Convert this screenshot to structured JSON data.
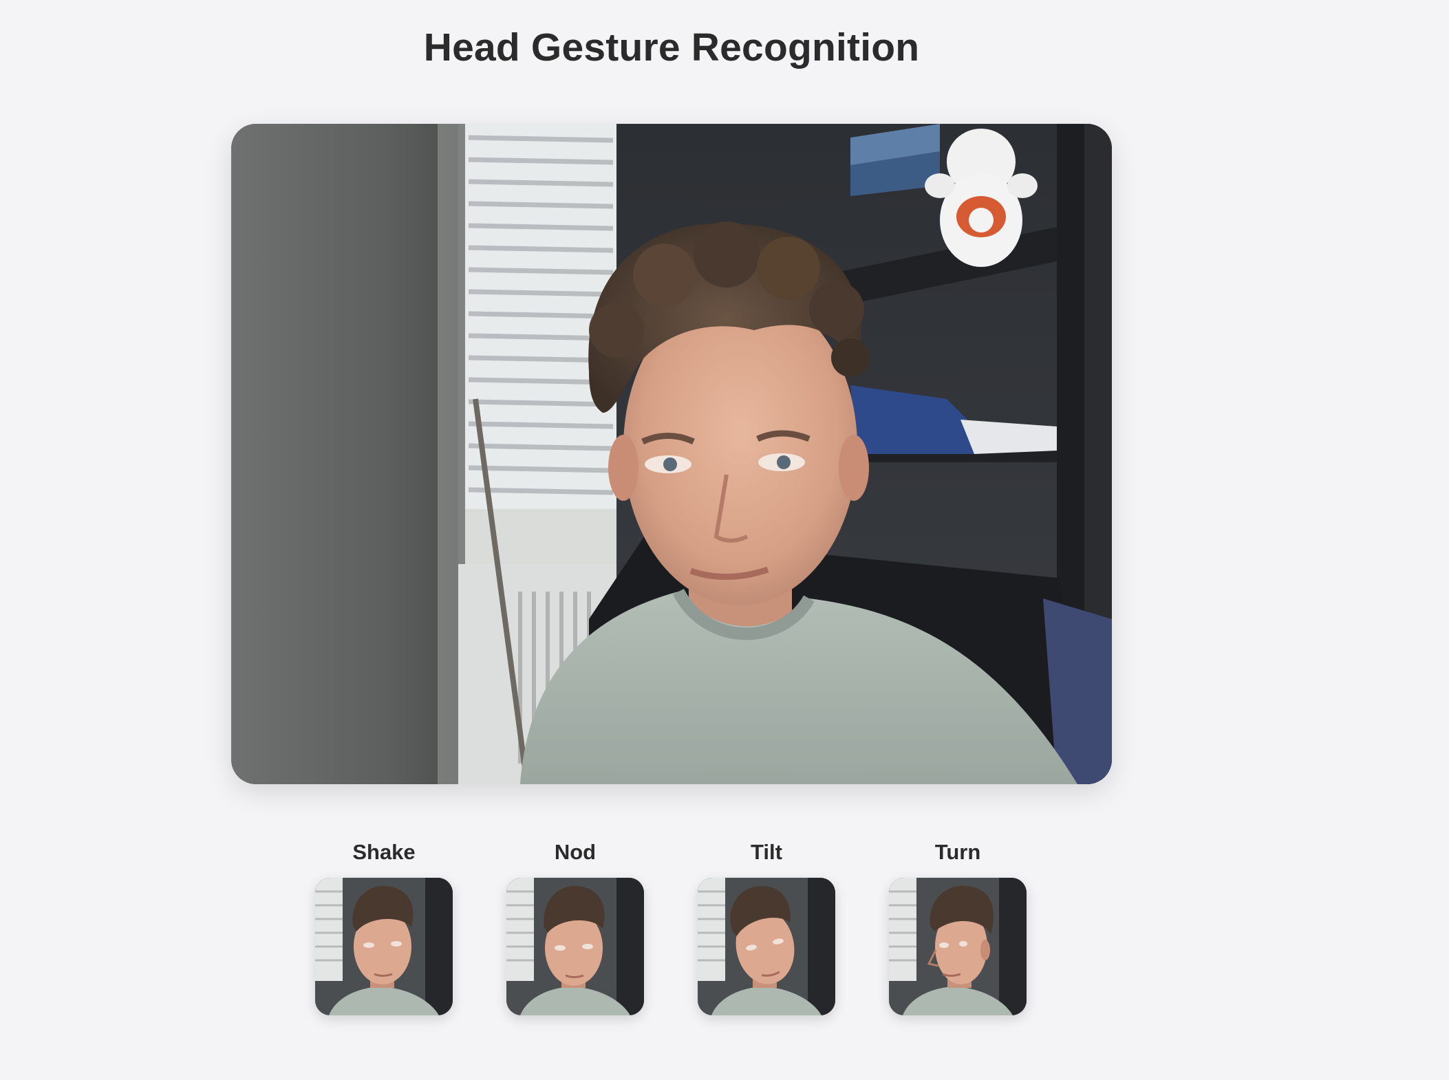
{
  "page": {
    "title": "Head Gesture Recognition"
  },
  "video": {
    "icon": "webcam-feed"
  },
  "gestures": [
    {
      "label": "Shake",
      "icon": "face-thumbnail"
    },
    {
      "label": "Nod",
      "icon": "face-thumbnail"
    },
    {
      "label": "Tilt",
      "icon": "face-thumbnail"
    },
    {
      "label": "Turn",
      "icon": "face-thumbnail"
    }
  ],
  "colors": {
    "background": "#f4f4f6",
    "title": "#2b2b2b",
    "shirt": "#a9b5ad",
    "hair": "#4a3a2f",
    "skin": "#d9a58b"
  }
}
